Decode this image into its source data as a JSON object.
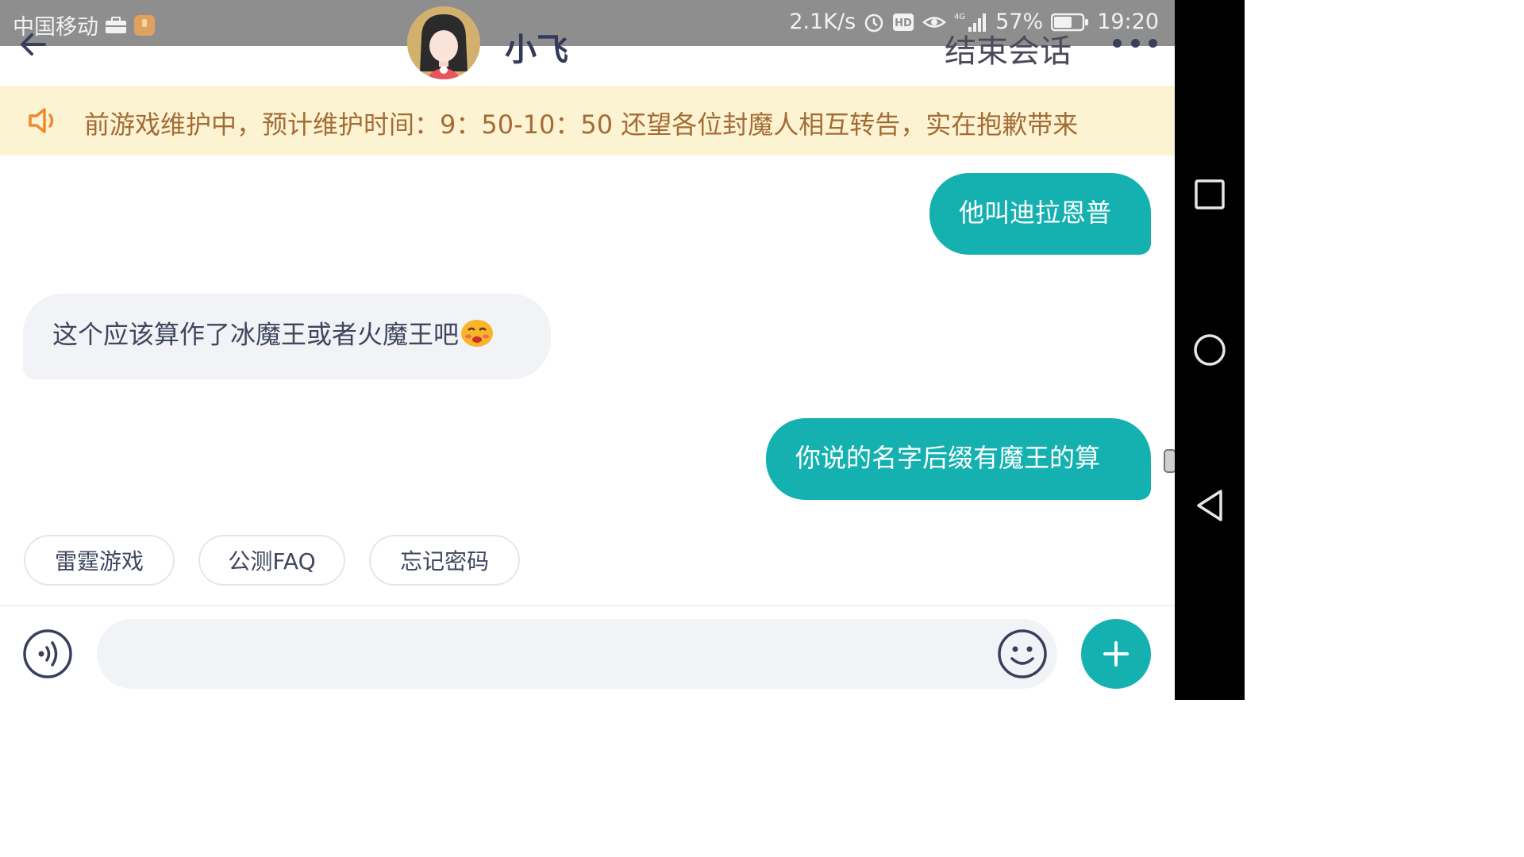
{
  "status_bar": {
    "carrier": "中国移动",
    "net_speed": "2.1K/s",
    "hd_label": "HD",
    "network_type": "4G",
    "battery_percent": "57%",
    "time": "19:20"
  },
  "header": {
    "agent_name": "小飞",
    "end_session_label": "结束会话"
  },
  "notice": {
    "text": "前游戏维护中，预计维护时间：9：50-10：50 还望各位封魔人相互转告，实在抱歉带来"
  },
  "messages": [
    {
      "sender": "user",
      "text": "他叫迪拉恩普"
    },
    {
      "sender": "agent",
      "text": "这个应该算作了冰魔王或者火魔王吧",
      "emoji": "sad-face-icon"
    },
    {
      "sender": "user",
      "text": "你说的名字后缀有魔王的算"
    }
  ],
  "quick_replies": [
    {
      "label": "雷霆游戏"
    },
    {
      "label": "公测FAQ"
    },
    {
      "label": "忘记密码"
    }
  ],
  "input": {
    "placeholder": "",
    "value": ""
  },
  "colors": {
    "accent": "#15b1b1",
    "notice_bg": "#fcf3d3",
    "notice_text": "#a46c35",
    "agent_bubble": "#f1f3f6",
    "header_text": "#333a5a"
  }
}
